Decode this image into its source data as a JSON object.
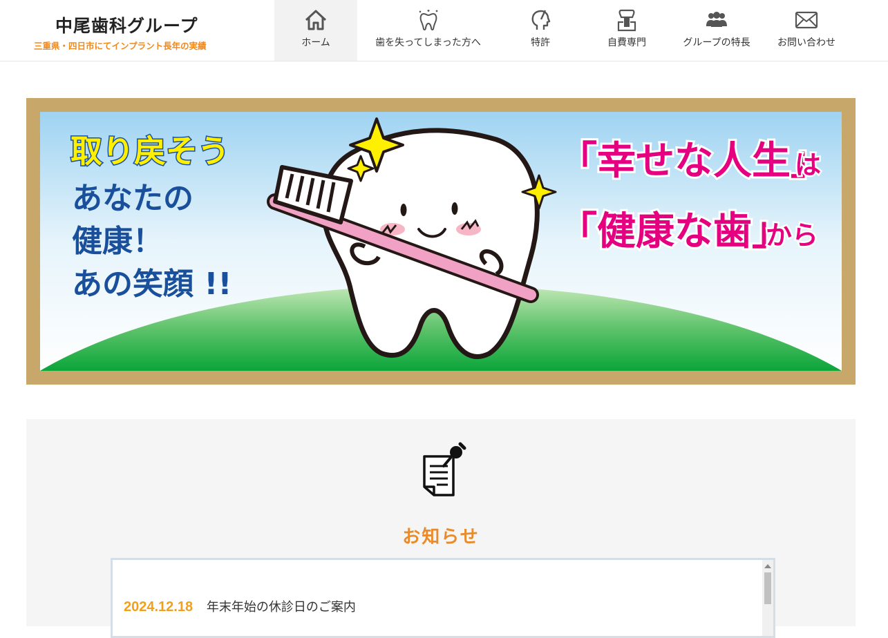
{
  "header": {
    "logo_title": "中尾歯科グループ",
    "logo_subtitle": "三重県・四日市にてインプラント長年の実績"
  },
  "nav": {
    "items": [
      {
        "label": "ホーム",
        "icon": "home-icon",
        "active": true
      },
      {
        "label": "歯を失ってしまった方へ",
        "icon": "tooth-icon",
        "active": false
      },
      {
        "label": "特許",
        "icon": "patent-head-icon",
        "active": false
      },
      {
        "label": "自費専門",
        "icon": "implant-icon",
        "active": false
      },
      {
        "label": "グループの特長",
        "icon": "group-people-icon",
        "active": false
      },
      {
        "label": "お問い合わせ",
        "icon": "mail-icon",
        "active": false
      }
    ]
  },
  "hero": {
    "headline_yellow": "取り戻そう",
    "lines_blue": [
      "あなたの",
      "健康！",
      "あの笑顔 !!"
    ],
    "slogan_line1_pink": "「幸せな人生」",
    "slogan_line1_small": "は",
    "slogan_line2_pink": "「健康な歯」",
    "slogan_line2_small": "から",
    "colors": {
      "frame": "#c8a86a",
      "pink": "#e5007f",
      "blue": "#1a4f9c",
      "yellow": "#fff000",
      "green": "#1aa83c"
    }
  },
  "notice": {
    "title": "お知らせ",
    "icon": "memo-pin-icon",
    "items": [
      {
        "date": "2024.12.18",
        "text": "年末年始の休診日のご案内"
      }
    ]
  }
}
